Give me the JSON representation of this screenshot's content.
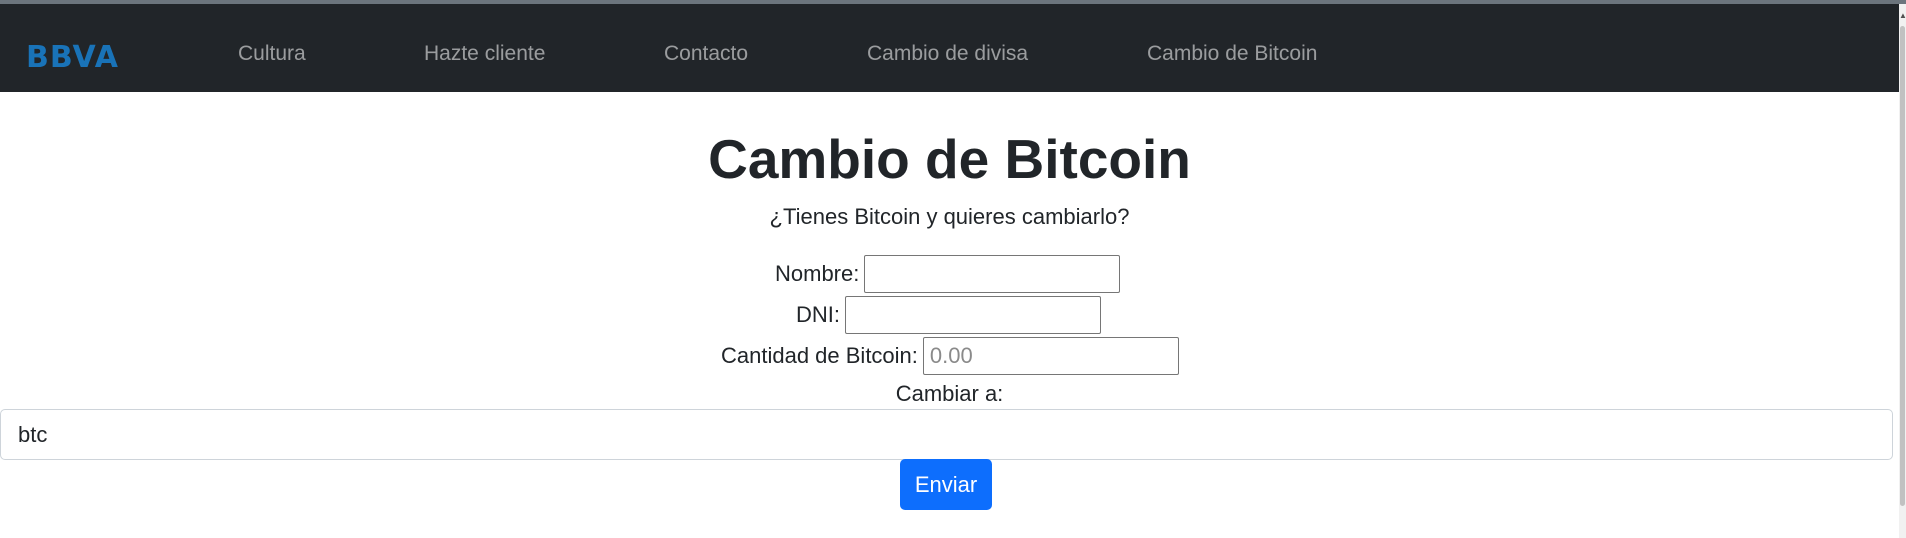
{
  "navbar": {
    "brand": "BBVA",
    "links": [
      {
        "label": "Cultura"
      },
      {
        "label": "Hazte cliente"
      },
      {
        "label": "Contacto"
      },
      {
        "label": "Cambio de divisa"
      },
      {
        "label": "Cambio de Bitcoin"
      }
    ]
  },
  "main": {
    "title": "Cambio de Bitcoin",
    "subtitle": "¿Tienes Bitcoin y quieres cambiarlo?",
    "form": {
      "nombre": {
        "label": "Nombre:",
        "value": "",
        "placeholder": ""
      },
      "dni": {
        "label": "DNI:",
        "value": "",
        "placeholder": ""
      },
      "cantidad": {
        "label": "Cantidad de Bitcoin:",
        "value": "",
        "placeholder": "0.00"
      },
      "cambiar": {
        "label": "Cambiar a:",
        "selected": "btc"
      },
      "submit_label": "Enviar"
    }
  },
  "colors": {
    "navbar_bg": "#212529",
    "brand": "#1973b8",
    "button_primary": "#0d6efd"
  }
}
